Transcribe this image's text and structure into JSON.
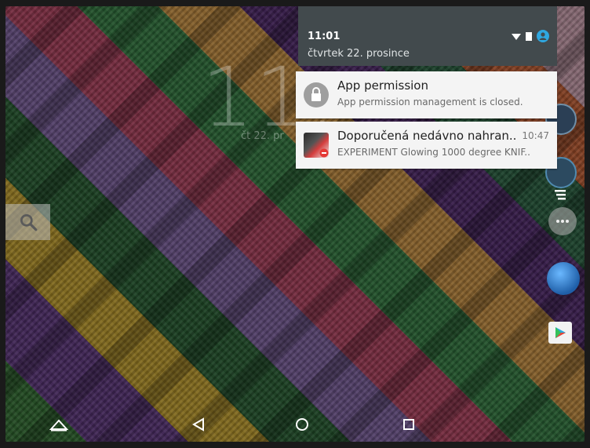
{
  "lockscreen": {
    "clock": "11:",
    "date": "čt 22. pr"
  },
  "notification_shade": {
    "time": "11:01",
    "date": "čtvrtek 22. prosince"
  },
  "notifications": [
    {
      "title": "App permission",
      "subtitle": "App permission management is closed.",
      "time": ""
    },
    {
      "title": "Doporučená nedávno nahran..",
      "subtitle": "EXPERIMENT Glowing 1000 degree KNIF..",
      "time": "10:47"
    }
  ],
  "colors": {
    "shade_bg": "#424a4d",
    "card_bg": "#f4f4f4",
    "accent": "#2fa7e0"
  },
  "icons": {
    "search": "search-icon",
    "wifi": "wifi-icon",
    "battery": "battery-icon",
    "account": "account-icon",
    "lock": "lock-icon"
  }
}
